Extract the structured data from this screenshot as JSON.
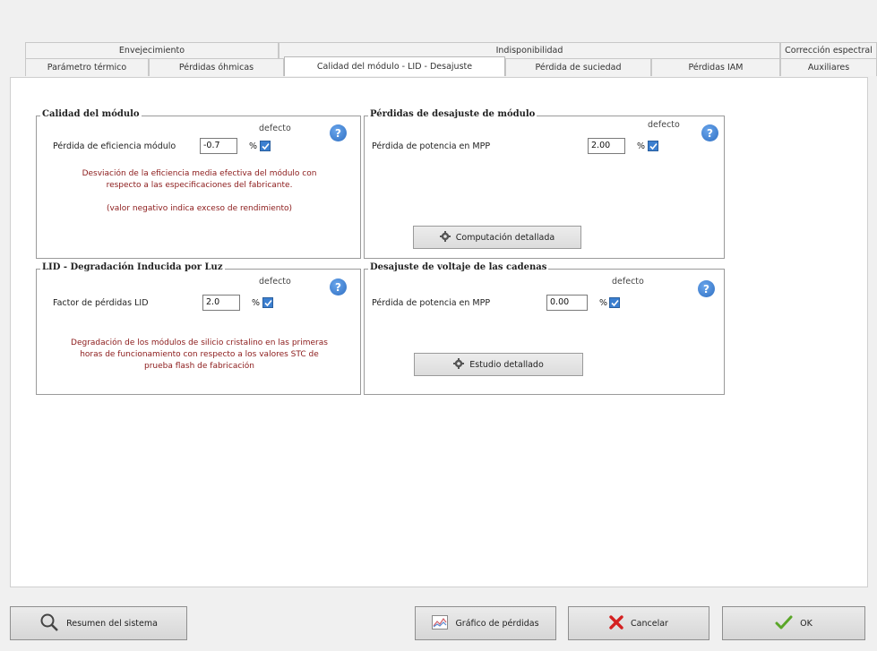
{
  "tabs_row1": [
    {
      "label": "Envejecimiento"
    },
    {
      "label": "Indisponibilidad"
    },
    {
      "label": "Corrección espectral"
    }
  ],
  "tabs_row2": [
    {
      "label": "Parámetro térmico"
    },
    {
      "label": "Pérdidas óhmicas"
    },
    {
      "label": "Calidad del módulo - LID - Desajuste"
    },
    {
      "label": "Pérdida de suciedad"
    },
    {
      "label": "Pérdidas IAM"
    },
    {
      "label": "Auxiliares"
    }
  ],
  "active_tab": "Calidad del módulo - LID - Desajuste",
  "module_quality": {
    "title": "Calidad del módulo",
    "default_label": "defecto",
    "field_label": "Pérdida de eficiencia módulo",
    "value": "-0.7",
    "unit": "%",
    "default_checked": true,
    "note_line1": "Desviación de la eficiencia media efectiva del módulo con",
    "note_line2": "respecto a las especificaciones del fabricante.",
    "note_line3": "(valor negativo indica exceso de rendimiento)"
  },
  "mismatch": {
    "title": "Pérdidas de desajuste de módulo",
    "default_label": "defecto",
    "field_label": "Pérdida de potencia en MPP",
    "value": "2.00",
    "unit": "%",
    "default_checked": true,
    "button_label": "Computación detallada"
  },
  "lid": {
    "title": "LID - Degradación Inducida por Luz",
    "default_label": "defecto",
    "field_label": "Factor de pérdidas LID",
    "value": "2.0",
    "unit": "%",
    "default_checked": true,
    "note_line1": "Degradación de los módulos de silicio cristalino en las primeras",
    "note_line2": "horas de funcionamiento con respecto a los valores STC de",
    "note_line3": "prueba flash de fabricación"
  },
  "string_voltage": {
    "title": "Desajuste de voltaje de las cadenas",
    "default_label": "defecto",
    "field_label": "Pérdida de potencia en MPP",
    "value": "0.00",
    "unit": "%",
    "default_checked": true,
    "button_label": "Estudio detallado"
  },
  "footer": {
    "summary_label": "Resumen del sistema",
    "loss_chart_label": "Gráfico de pérdidas",
    "cancel_label": "Cancelar",
    "ok_label": "OK"
  },
  "colors": {
    "accent": "#3b7fd0",
    "note_text": "#8b1a1a",
    "cancel_icon": "#d42020",
    "ok_icon": "#5aa628"
  },
  "icons": {
    "help": "help-icon",
    "gear": "gear-icon",
    "search": "search-icon",
    "chart": "chart-icon",
    "cancel": "close-icon",
    "ok": "check-icon"
  }
}
